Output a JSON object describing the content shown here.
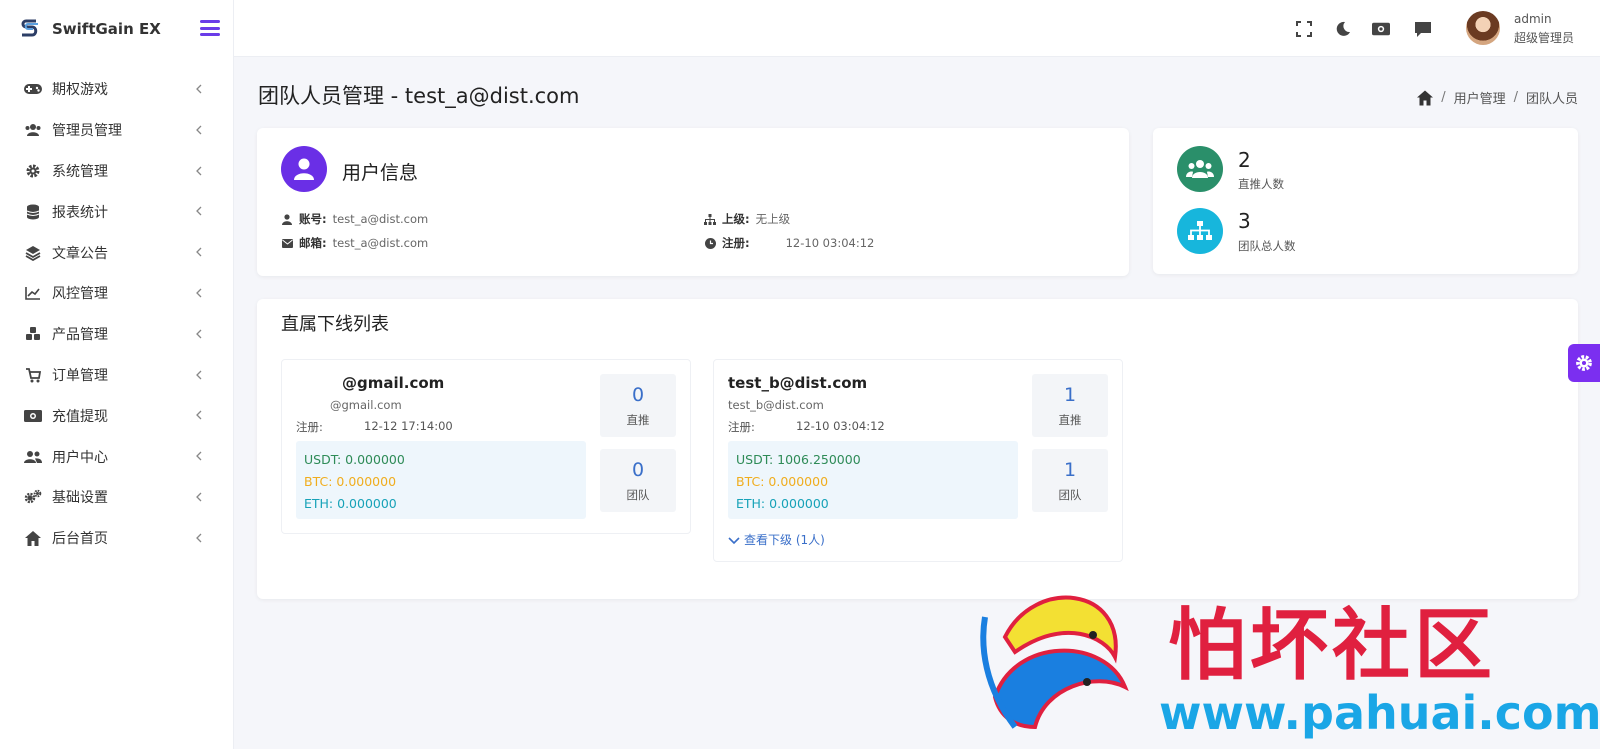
{
  "brand": {
    "name": "SwiftGain EX"
  },
  "sidebar": {
    "items": [
      {
        "label": "期权游戏",
        "icon": "gamepad-icon"
      },
      {
        "label": "管理员管理",
        "icon": "users-icon"
      },
      {
        "label": "系统管理",
        "icon": "gear-icon"
      },
      {
        "label": "报表统计",
        "icon": "database-icon"
      },
      {
        "label": "文章公告",
        "icon": "layers-icon"
      },
      {
        "label": "风控管理",
        "icon": "line-chart-icon"
      },
      {
        "label": "产品管理",
        "icon": "cubes-icon"
      },
      {
        "label": "订单管理",
        "icon": "cart-icon"
      },
      {
        "label": "充值提现",
        "icon": "money-icon"
      },
      {
        "label": "用户中心",
        "icon": "user-group-icon"
      },
      {
        "label": "基础设置",
        "icon": "cogs-icon"
      },
      {
        "label": "后台首页",
        "icon": "home-icon"
      }
    ]
  },
  "topbar": {
    "user_name": "admin",
    "user_role": "超级管理员"
  },
  "page": {
    "title": "团队人员管理 - test_a@dist.com",
    "breadcrumb": [
      "用户管理",
      "团队人员"
    ]
  },
  "user_info": {
    "heading": "用户信息",
    "account_key": "账号:",
    "account_val": "test_a@dist.com",
    "email_key": "邮箱:",
    "email_val": "test_a@dist.com",
    "parent_key": "上级:",
    "parent_val": "无上级",
    "reg_key": "注册:",
    "reg_val": "12-10 03:04:12"
  },
  "stats": {
    "direct_count": "2",
    "direct_label": "直推人数",
    "team_count": "3",
    "team_label": "团队总人数"
  },
  "downline": {
    "title": "直属下线列表",
    "members": [
      {
        "name": "@gmail.com",
        "email": "@gmail.com",
        "reg_label": "注册:",
        "reg_time": "12-12 17:14:00",
        "usdt": "USDT: 0.000000",
        "btc": "BTC: 0.000000",
        "eth": "ETH: 0.000000",
        "direct": "0",
        "direct_label": "直推",
        "team": "0",
        "team_label": "团队"
      },
      {
        "name": "test_b@dist.com",
        "email": "test_b@dist.com",
        "reg_label": "注册:",
        "reg_time": "12-10 03:04:12",
        "usdt": "USDT: 1006.250000",
        "btc": "BTC: 0.000000",
        "eth": "ETH: 0.000000",
        "direct": "1",
        "direct_label": "直推",
        "team": "1",
        "team_label": "团队",
        "view_more": "查看下级 (1人)"
      }
    ]
  },
  "colors": {
    "accent": "#6a2fe6",
    "usdt": "#2e8b57",
    "btc": "#f0ad1e",
    "eth": "#17a2b8",
    "link": "#3a6fc9"
  },
  "watermark": {
    "text": "怕坏社区",
    "url": "www.pahuai.com"
  }
}
